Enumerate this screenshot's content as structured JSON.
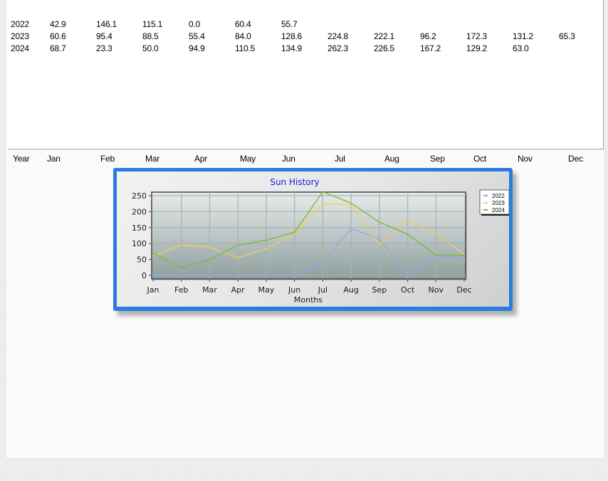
{
  "table": {
    "rows": [
      {
        "year": "2022",
        "values": [
          "42.9",
          "146.1",
          "115.1",
          "0.0",
          "60.4",
          "55.7"
        ]
      },
      {
        "year": "2023",
        "values": [
          "60.6",
          "95.4",
          "88.5",
          "55.4",
          "84.0",
          "128.6",
          "224.8",
          "222.1",
          "96.2",
          "172.3",
          "131.2",
          "65.3"
        ]
      },
      {
        "year": "2024",
        "values": [
          "68.7",
          "23.3",
          "50.0",
          "94.9",
          "110.5",
          "134.9",
          "262.3",
          "226.5",
          "167.2",
          "129.2",
          "63.0"
        ]
      }
    ],
    "header": [
      "Year",
      "Jan",
      "Feb",
      "Mar",
      "Apr",
      "May",
      "Jun",
      "Jul",
      "Aug",
      "Sep",
      "Oct",
      "Nov",
      "Dec"
    ]
  },
  "chart_data": {
    "type": "line",
    "title": "Sun History",
    "xlabel": "Months",
    "ylabel": "",
    "categories": [
      "Jan",
      "Feb",
      "Mar",
      "Apr",
      "May",
      "Jun",
      "Jul",
      "Aug",
      "Sep",
      "Oct",
      "Nov",
      "Dec"
    ],
    "yticks": [
      0,
      50,
      100,
      150,
      200,
      250
    ],
    "ylim": [
      -10,
      275
    ],
    "grid": true,
    "legend": "top-right",
    "series": [
      {
        "name": "2022",
        "color": "#8aa8f0",
        "values": [
          0,
          0,
          0,
          0,
          0,
          0,
          42.9,
          146.1,
          115.1,
          0.0,
          60.4,
          55.7
        ]
      },
      {
        "name": "2023",
        "color": "#f0d050",
        "values": [
          60.6,
          95.4,
          88.5,
          55.4,
          84.0,
          128.6,
          224.8,
          222.1,
          96.2,
          172.3,
          131.2,
          65.3
        ]
      },
      {
        "name": "2024",
        "color": "#78b83a",
        "values": [
          68.7,
          23.3,
          50.0,
          94.9,
          110.5,
          134.9,
          262.3,
          226.5,
          167.2,
          129.2,
          63.0,
          63.0
        ]
      }
    ]
  }
}
